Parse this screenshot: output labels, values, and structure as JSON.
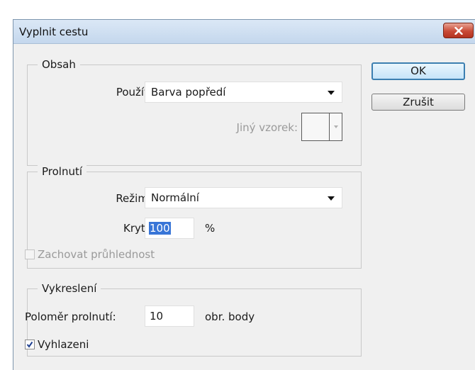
{
  "window": {
    "title": "Vyplnit cestu"
  },
  "buttons": {
    "ok": "OK",
    "cancel": "Zrušit"
  },
  "contents": {
    "legend": "Obsah",
    "use_label": "Použít:",
    "use_value": "Barva popředí",
    "custom_pattern_label": "Jiný vzorek:"
  },
  "blending": {
    "legend": "Prolnutí",
    "mode_label": "Režim:",
    "mode_value": "Normální",
    "opacity_label": "Krytí:",
    "opacity_value": "100",
    "opacity_unit": "%",
    "preserve_transparency_label": "Zachovat průhlednost",
    "preserve_transparency_checked": false
  },
  "rendering": {
    "legend": "Vykreslení",
    "feather_label": "Poloměr prolnutí:",
    "feather_value": "10",
    "feather_unit": "obr. body",
    "antialias_label": "Vyhlazeni",
    "antialias_checked": true
  },
  "colors": {
    "close_red": "#c94a36",
    "selection": "#3875d7",
    "disabled_text": "#9a9a9a"
  },
  "icons": {
    "close": "close-icon",
    "dropdown": "chevron-down-icon",
    "check": "checkmark-icon"
  }
}
